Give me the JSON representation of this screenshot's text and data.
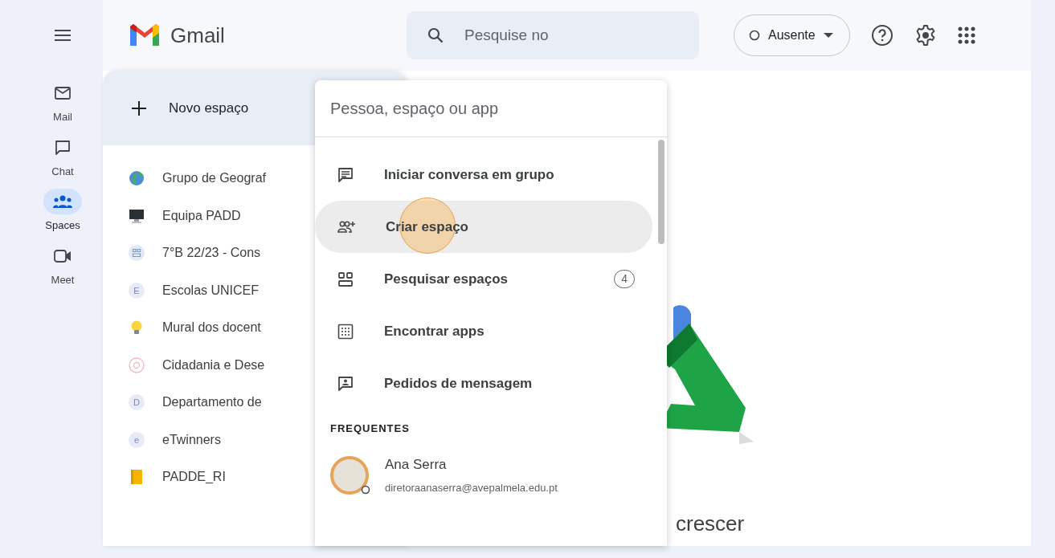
{
  "header": {
    "app_name": "Gmail",
    "search": {
      "placeholder": "Pesquise no"
    },
    "status": {
      "label": "Ausente"
    }
  },
  "rail": {
    "items": [
      {
        "label": "Mail",
        "kind": "mail",
        "selected": false
      },
      {
        "label": "Chat",
        "kind": "chat",
        "selected": false
      },
      {
        "label": "Spaces",
        "kind": "spaces",
        "selected": true
      },
      {
        "label": "Meet",
        "kind": "meet",
        "selected": false
      }
    ]
  },
  "spaces_panel": {
    "new_space": "Novo espaço",
    "spaces": [
      {
        "name": "Grupo de Geograf",
        "kind": "globe"
      },
      {
        "name": "Equipa PADD",
        "kind": "monitor"
      },
      {
        "name": "7°B 22/23 - Cons",
        "kind": "grid"
      },
      {
        "name": "Escolas UNICEF",
        "kind": "initial",
        "initial": "E"
      },
      {
        "name": "Mural dos docent",
        "kind": "bulb"
      },
      {
        "name": "Cidadania e Dese",
        "kind": "flower"
      },
      {
        "name": "Departamento de",
        "kind": "initial",
        "initial": "D"
      },
      {
        "name": "eTwinners",
        "kind": "initial",
        "initial": "e"
      },
      {
        "name": "PADDE_RI",
        "kind": "notebook"
      }
    ]
  },
  "popover": {
    "search": {
      "placeholder": "Pessoa, espaço ou app"
    },
    "actions": [
      {
        "label": "Iniciar conversa em grupo",
        "kind": "message",
        "selected": false
      },
      {
        "label": "Criar espaço",
        "kind": "addgroup",
        "selected": true
      },
      {
        "label": "Pesquisar espaços",
        "kind": "spaces",
        "selected": false,
        "count": "4"
      },
      {
        "label": "Encontrar apps",
        "kind": "apps",
        "selected": false
      },
      {
        "label": "Pedidos de mensagem",
        "kind": "request",
        "selected": false
      }
    ],
    "section_title": "FREQUENTES",
    "contacts": [
      {
        "name": "Ana Serra",
        "email": "diretoraanaserra@avepalmela.edu.pt"
      }
    ]
  },
  "main": {
    "caption": "crescer"
  }
}
